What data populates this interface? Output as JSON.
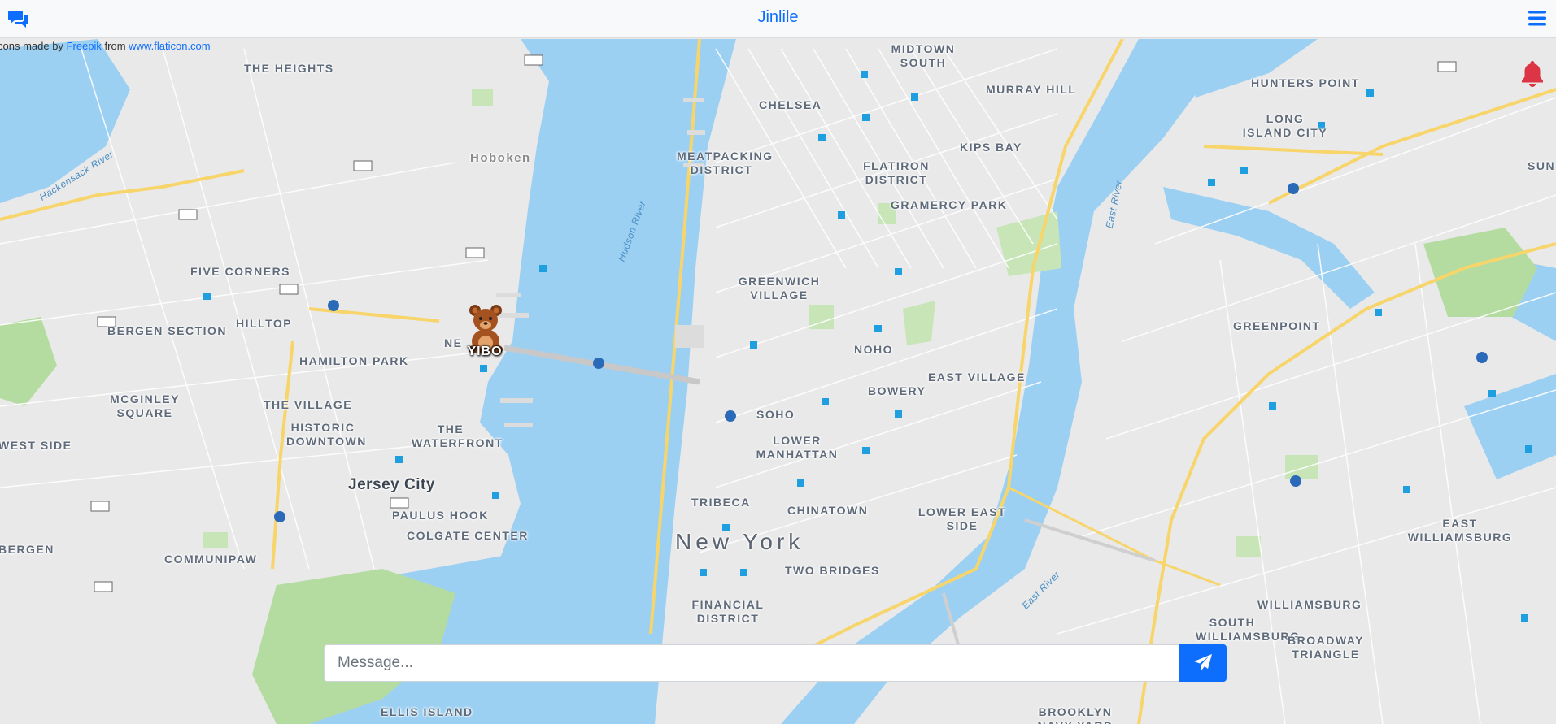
{
  "navbar": {
    "brand": "Jinlile",
    "chat_icon": "comments-icon",
    "menu_icon": "hamburger-menu-icon"
  },
  "attribution": {
    "prefix": "cons made by",
    "author": "Freepik",
    "middle": "from",
    "site": "www.flaticon.com"
  },
  "map": {
    "user_marker": {
      "name": "YIBO",
      "icon": "bear-icon"
    },
    "notification_icon": "bell-icon",
    "neighborhoods": [
      "THE HEIGHTS",
      "Hoboken",
      "MIDTOWN SOUTH",
      "MURRAY HILL",
      "HUNTERS POINT",
      "LONG ISLAND CITY",
      "CHELSEA",
      "MEATPACKING DISTRICT",
      "FLATIRON DISTRICT",
      "KIPS BAY",
      "GRAMERCY PARK",
      "FIVE CORNERS",
      "GREENWICH VILLAGE",
      "BERGEN SECTION",
      "HILLTOP",
      "HAMILTON PARK",
      "NOHO",
      "EAST VILLAGE",
      "GREENPOINT",
      "MCGINLEY SQUARE",
      "THE VILLAGE",
      "BOWERY",
      "HISTORIC DOWNTOWN",
      "THE WATERFRONT",
      "SOHO",
      "LOWER MANHATTAN",
      "WEST SIDE",
      "Jersey City",
      "PAULUS HOOK",
      "TRIBECA",
      "CHINATOWN",
      "LOWER EAST SIDE",
      "COLGATE CENTER",
      "EAST WILLIAMSBURG",
      "BERGEN",
      "COMMUNIPAW",
      "New York",
      "TWO BRIDGES",
      "FINANCIAL DISTRICT",
      "WILLIAMSBURG",
      "SOUTH WILLIAMSBURG",
      "BROADWAY TRIANGLE",
      "ELLIS ISLAND",
      "BROOKLYN NAVY YARD",
      "SUN"
    ],
    "water_labels": [
      "Hackensack River",
      "Hudson River",
      "East River",
      "East River"
    ],
    "partial_labels": [
      "NE"
    ]
  },
  "message": {
    "placeholder": "Message...",
    "send_icon": "paper-plane-icon"
  },
  "colors": {
    "accent": "#0d6efd",
    "water": "#9cd0f3",
    "land": "#e9e9e9",
    "park": "#b4dca0",
    "highway": "#f7d56a",
    "bell": "#dc3545"
  }
}
